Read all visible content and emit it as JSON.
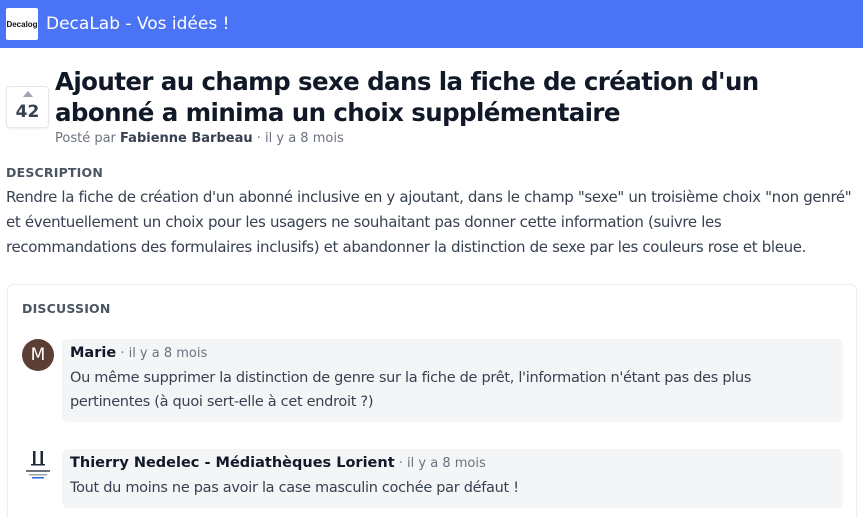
{
  "header": {
    "logo_text": "Decalog",
    "title": "DecaLab - Vos idées !",
    "background_color": "#4a74f5"
  },
  "post": {
    "votes": "42",
    "title": "Ajouter au champ sexe dans la fiche de création d'un abonné a minima un choix supplémentaire",
    "posted_by_prefix": "Posté par",
    "author": "Fabienne Barbeau",
    "time": "· il y a 8 mois"
  },
  "description": {
    "label": "DESCRIPTION",
    "text": "Rendre la fiche de création d'un abonné inclusive en y ajoutant, dans le champ \"sexe\" un troisième choix \"non genré\" et éventuellement un choix pour les usagers ne souhaitant pas donner cette information (suivre les recommandations des formulaires inclusifs) et abandonner la distinction de sexe par les couleurs rose et bleue."
  },
  "discussion": {
    "label": "DISCUSSION",
    "comments": [
      {
        "avatar_letter": "M",
        "author": "Marie",
        "time": "· il y a 8 mois",
        "text": "Ou même supprimer la distinction de genre sur la fiche de prêt, l'information n'étant pas des plus pertinentes (à quoi sert-elle à cet endroit ?)"
      },
      {
        "avatar_logo": "Médiathèque",
        "author": "Thierry Nedelec - Médiathèques Lorient",
        "time": "· il y a 8 mois",
        "text": "Tout du moins ne pas avoir la case masculin cochée par défaut !"
      }
    ]
  }
}
